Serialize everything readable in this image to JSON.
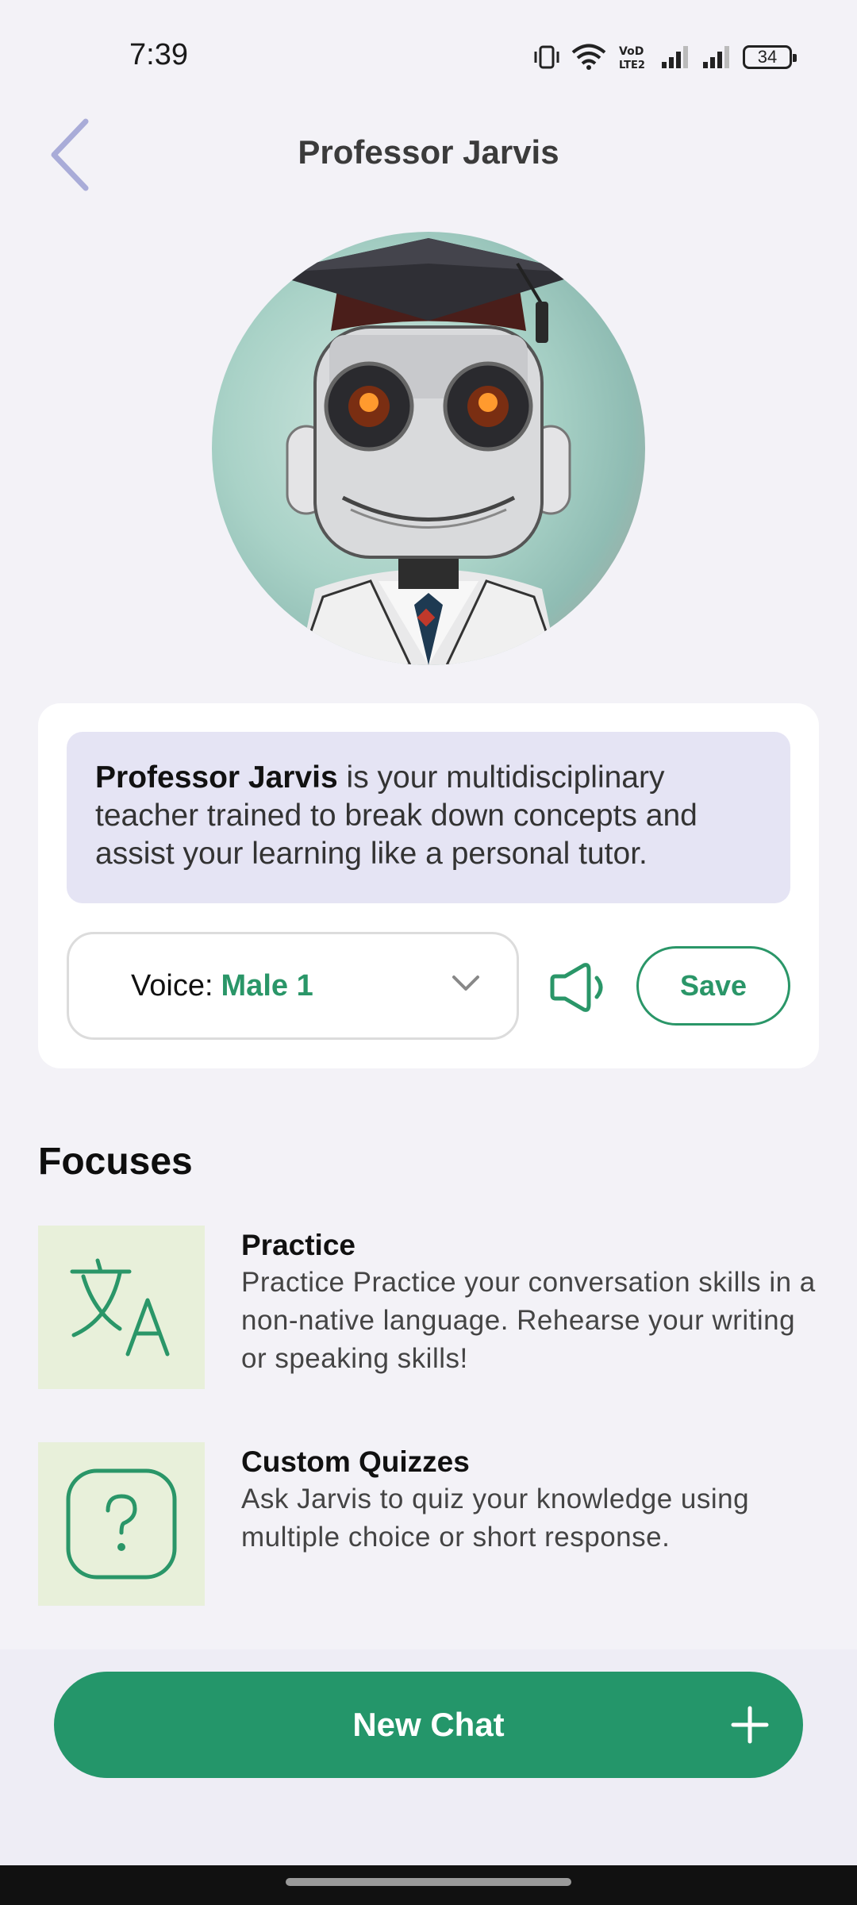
{
  "status_bar": {
    "time": "7:39",
    "battery": "34",
    "icons": [
      "vibrate-icon",
      "wifi-icon",
      "volte-icon",
      "signal-icon",
      "signal-icon",
      "battery-icon"
    ]
  },
  "header": {
    "title": "Professor Jarvis",
    "back_icon": "chevron-left-icon"
  },
  "avatar": {
    "description": "robot-professor-avatar"
  },
  "info": {
    "name": "Professor Jarvis",
    "description": " is your multidisciplinary teacher trained to break down concepts and assist your learning like a personal tutor.",
    "voice_label": "Voice:",
    "voice_value": "Male 1",
    "save_label": "Save"
  },
  "focuses": {
    "title": "Focuses",
    "items": [
      {
        "title": "Practice",
        "description": "Practice Practice your conversation skills in a non-native language. Rehearse your writing or speaking skills!",
        "icon": "translate-icon"
      },
      {
        "title": "Custom Quizzes",
        "description": "Ask Jarvis to quiz your knowledge using multiple choice or short response.",
        "icon": "question-icon"
      }
    ]
  },
  "footer": {
    "new_chat_label": "New Chat"
  },
  "colors": {
    "accent": "#24966a",
    "background": "#f3f2f7",
    "description_bg": "#e5e4f4",
    "focus_icon_bg": "#e8f0da",
    "back_icon": "#a9acd8"
  }
}
